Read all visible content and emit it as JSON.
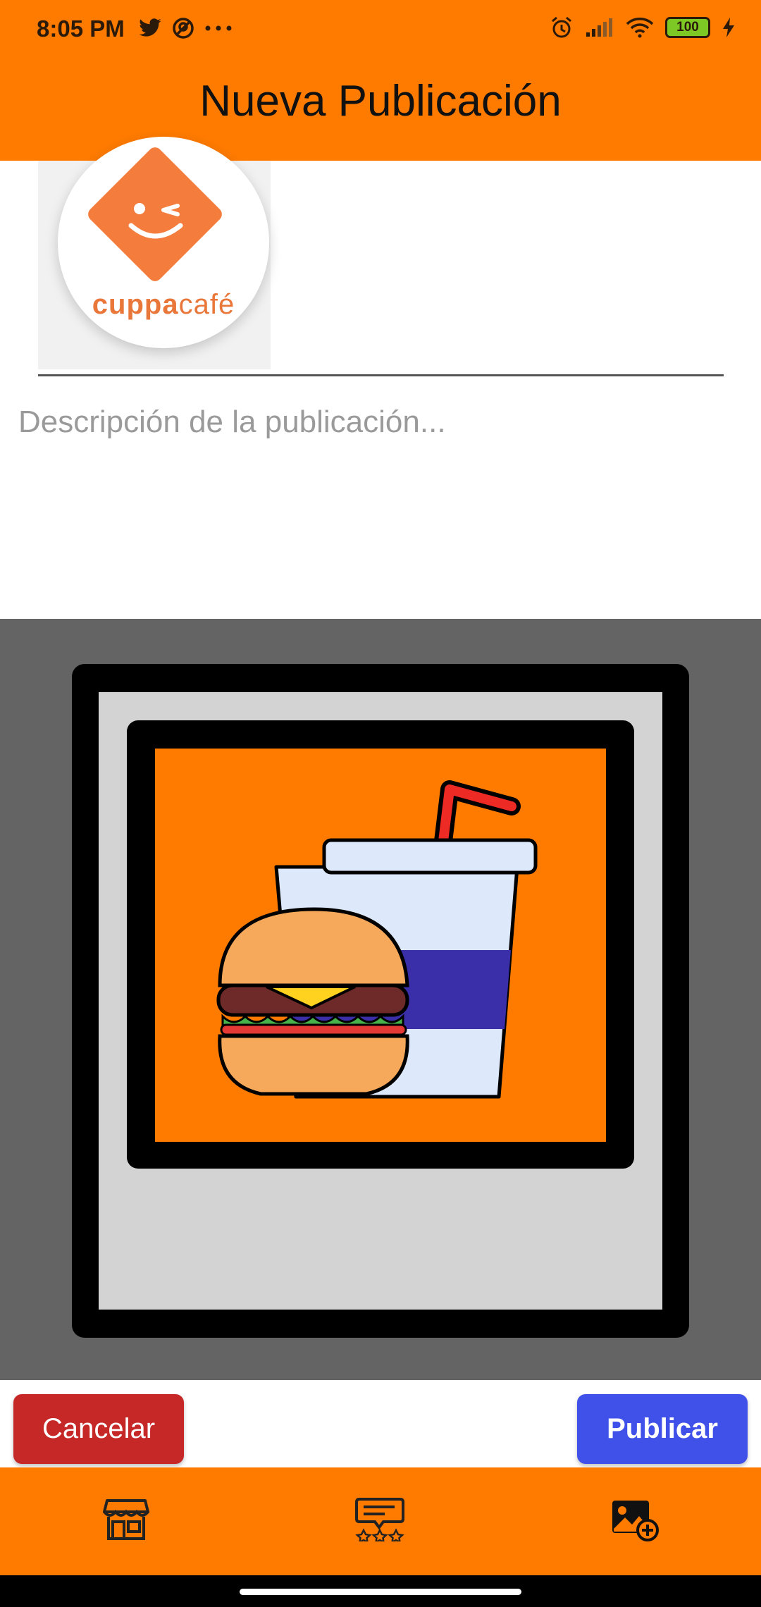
{
  "status_bar": {
    "time": "8:05 PM",
    "battery_level": "100",
    "left_icons": [
      "twitter-icon",
      "notification-app-icon",
      "more-dots-icon"
    ],
    "right_icons": [
      "alarm-icon",
      "cell-signal-icon",
      "wifi-icon",
      "battery-icon",
      "charging-bolt-icon"
    ]
  },
  "header": {
    "title": "Nueva Publicación"
  },
  "profile": {
    "logo_text_bold": "cuppa",
    "logo_text_regular": "café",
    "brand_color": "#F47C3C"
  },
  "post": {
    "description_value": "",
    "description_placeholder": "Descripción de la publicación..."
  },
  "image_preview": {
    "icon": "burger-and-drink-image-placeholder"
  },
  "actions": {
    "cancel_label": "Cancelar",
    "publish_label": "Publicar"
  },
  "bottom_nav": {
    "items": [
      {
        "icon": "store-icon"
      },
      {
        "icon": "reviews-icon"
      },
      {
        "icon": "add-image-icon"
      }
    ]
  },
  "colors": {
    "accent": "#FF7B00",
    "cancel": "#C62828",
    "publish": "#3F51E8",
    "image_background": "#646464"
  }
}
